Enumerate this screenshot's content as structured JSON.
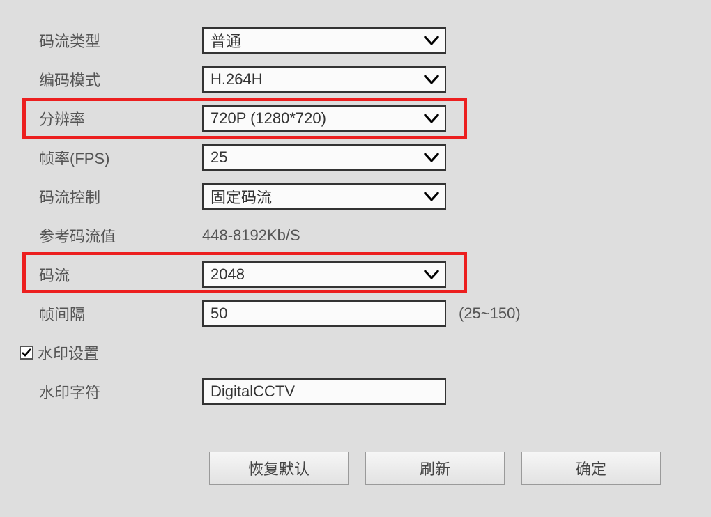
{
  "labels": {
    "streamType": "码流类型",
    "encodeMode": "编码模式",
    "resolution": "分辨率",
    "frameRate": "帧率(FPS)",
    "bitRateControl": "码流控制",
    "refBitRate": "参考码流值",
    "bitRate": "码流",
    "iFrameInterval": "帧间隔",
    "watermark": "水印设置",
    "watermarkChars": "水印字符"
  },
  "values": {
    "streamType": "普通",
    "encodeMode": "H.264H",
    "resolution": "720P (1280*720)",
    "frameRate": "25",
    "bitRateControl": "固定码流",
    "refBitRate": "448-8192Kb/S",
    "bitRate": "2048",
    "iFrameInterval": "50",
    "iFrameHint": "(25~150)",
    "watermarkChecked": true,
    "watermarkChars": "DigitalCCTV"
  },
  "buttons": {
    "restoreDefault": "恢复默认",
    "refresh": "刷新",
    "confirm": "确定"
  }
}
